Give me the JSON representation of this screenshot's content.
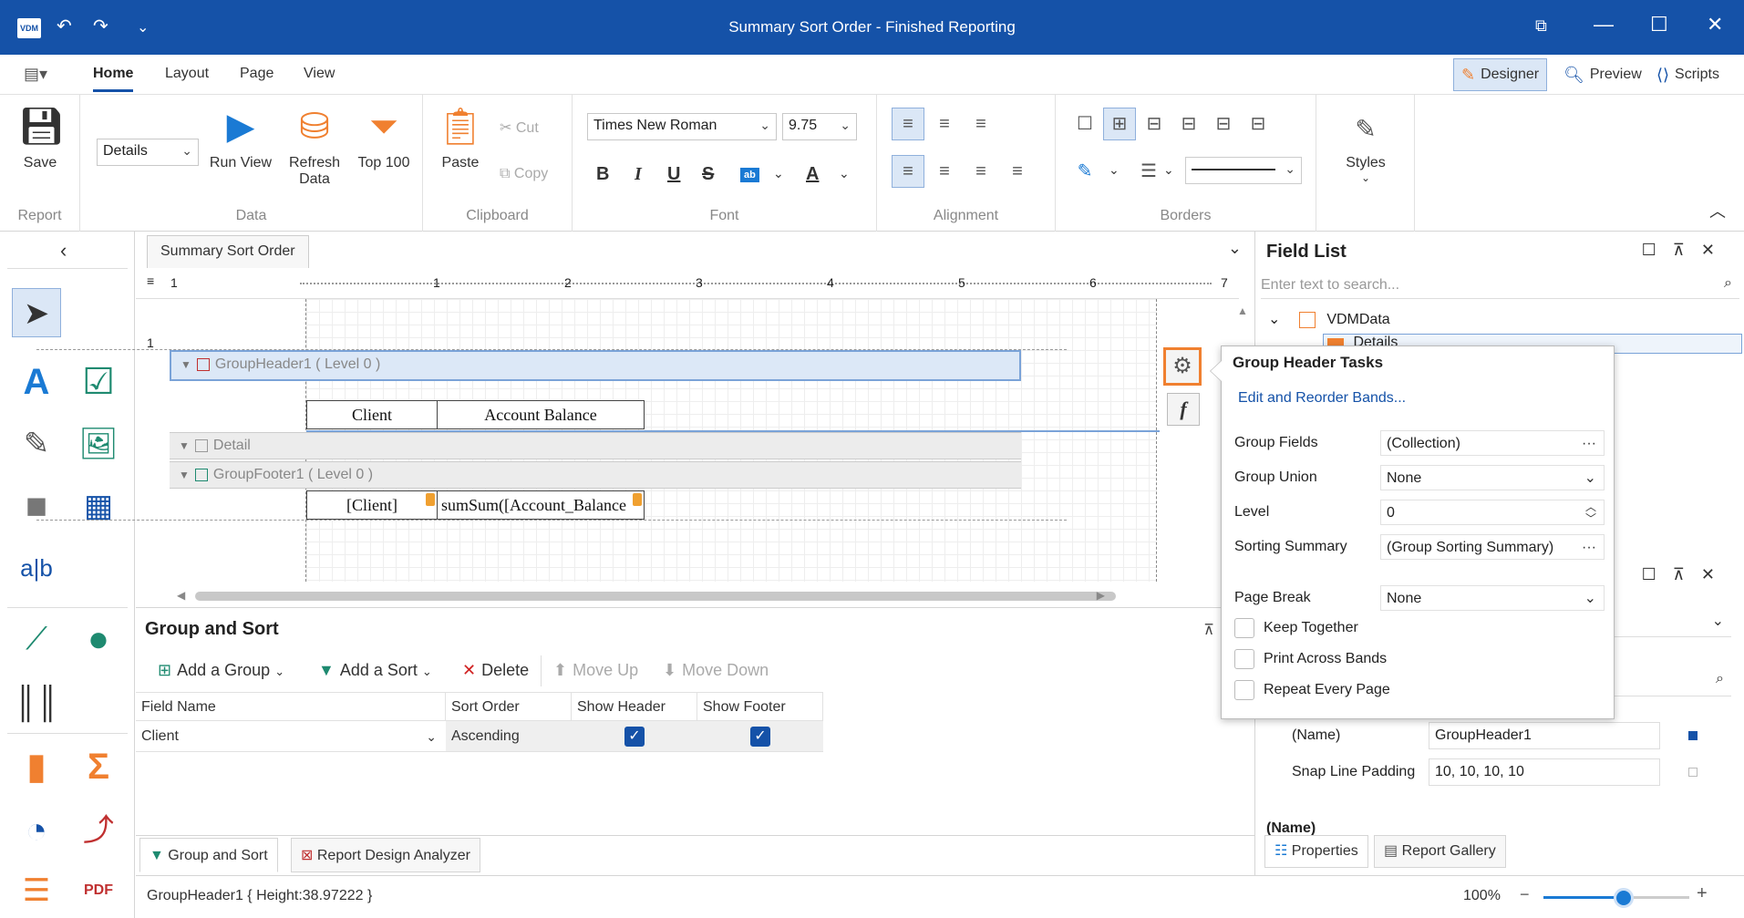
{
  "app": {
    "title": "Summary Sort Order - Finished Reporting",
    "logo": "VDM"
  },
  "menu": {
    "tabs": [
      "Home",
      "Layout",
      "Page",
      "View"
    ],
    "active_tab": "Home",
    "modes": [
      "Designer",
      "Preview",
      "Scripts"
    ],
    "active_mode": "Designer"
  },
  "ribbon": {
    "report": {
      "save": "Save",
      "label": "Report"
    },
    "data": {
      "combo": "Details",
      "run_view": "Run View",
      "refresh": "Refresh Data",
      "top100": "Top 100",
      "label": "Data"
    },
    "clipboard": {
      "paste": "Paste",
      "cut": "Cut",
      "copy": "Copy",
      "label": "Clipboard"
    },
    "font": {
      "family": "Times New Roman",
      "size": "9.75",
      "label": "Font"
    },
    "alignment": {
      "label": "Alignment"
    },
    "borders": {
      "label": "Borders"
    },
    "styles": {
      "label": "Styles"
    }
  },
  "document": {
    "tab": "Summary Sort Order",
    "ruler_numbers": [
      "1",
      "1",
      "2",
      "3",
      "4",
      "5",
      "6",
      "7"
    ],
    "bands": {
      "group_header": "GroupHeader1 ( Level 0 )",
      "detail": "Detail",
      "group_footer": "GroupFooter1 ( Level 0 )"
    },
    "cells": {
      "client": "Client",
      "account_balance": "Account Balance",
      "client_field": "[Client]",
      "sum_field": "sumSum([Account_Balance"
    },
    "vruler_mark": "1"
  },
  "group_sort": {
    "title": "Group and Sort",
    "buttons": {
      "add_group": "Add a Group",
      "add_sort": "Add a Sort",
      "delete": "Delete",
      "move_up": "Move Up",
      "move_down": "Move Down"
    },
    "columns": [
      "Field Name",
      "Sort Order",
      "Show Header",
      "Show Footer"
    ],
    "rows": [
      {
        "field": "Client",
        "sort": "Ascending",
        "show_header": true,
        "show_footer": true
      }
    ]
  },
  "bottom_tabs": [
    "Group and Sort",
    "Report Design Analyzer"
  ],
  "status": {
    "text": "GroupHeader1 { Height:38.97222 }",
    "zoom": "100%",
    "zoom_level": 0.55
  },
  "field_list": {
    "title": "Field List",
    "search_placeholder": "Enter text to search...",
    "tree": [
      "VDMData",
      "Details"
    ]
  },
  "tasks": {
    "title": "Group Header Tasks",
    "link": "Edit and Reorder Bands...",
    "props": [
      {
        "label": "Group Fields",
        "value": "(Collection)",
        "ctrl": "ellipsis"
      },
      {
        "label": "Group Union",
        "value": "None",
        "ctrl": "dropdown"
      },
      {
        "label": "Level",
        "value": "0",
        "ctrl": "spin"
      },
      {
        "label": "Sorting Summary",
        "value": "(Group Sorting Summary)",
        "ctrl": "ellipsis"
      },
      {
        "label": "Page Break",
        "value": "None",
        "ctrl": "dropdown"
      }
    ],
    "checks": [
      "Keep Together",
      "Print Across Bands",
      "Repeat Every Page"
    ]
  },
  "properties": {
    "name_label": "(Name)",
    "name_value": "GroupHeader1",
    "snap_label": "Snap Line Padding",
    "snap_value": "10, 10, 10, 10",
    "section_label": "(Name)",
    "tabs": [
      "Properties",
      "Report Gallery"
    ]
  },
  "colors": {
    "accent": "#1552a8",
    "highlight": "#f08030"
  }
}
